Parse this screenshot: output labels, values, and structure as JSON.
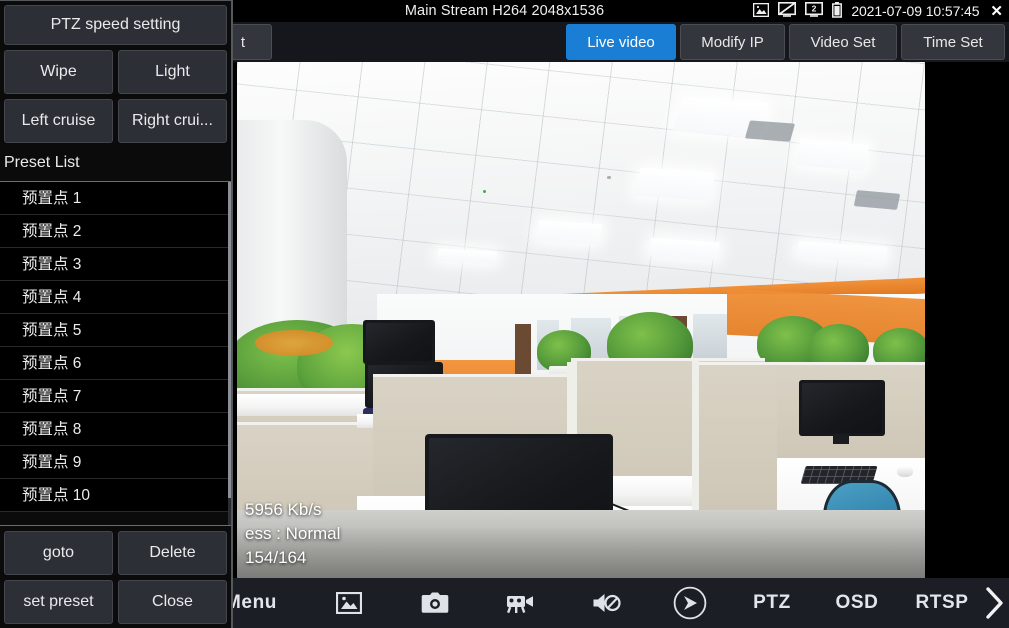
{
  "statusbar": {
    "stream_title": "Main Stream H264 2048x1536",
    "datetime": "2021-07-09 10:57:45",
    "close_label": "✕",
    "icons": [
      {
        "name": "picture-icon",
        "glyph": "image"
      },
      {
        "name": "screen-off-icon",
        "glyph": "monitor-crossed"
      },
      {
        "name": "screen-two-icon",
        "glyph": "monitor-2"
      },
      {
        "name": "battery-icon",
        "glyph": "battery"
      }
    ]
  },
  "tabs": {
    "hidden_label": "t",
    "items": [
      {
        "label": "Live video",
        "active": true
      },
      {
        "label": "Modify IP",
        "active": false
      },
      {
        "label": "Video Set",
        "active": false
      },
      {
        "label": "Time Set",
        "active": false
      }
    ]
  },
  "video": {
    "osd": {
      "bitrate": "5956 Kb/s",
      "progress": "ess : Normal",
      "frames": "154/164"
    }
  },
  "toolbar": {
    "menu_label": "Menu",
    "ptz_label": "PTZ",
    "osd_label": "OSD",
    "rtsp_label": "RTSP",
    "icons": [
      {
        "name": "picture-icon"
      },
      {
        "name": "camera-icon"
      },
      {
        "name": "video-camera-icon"
      },
      {
        "name": "mute-speaker-icon"
      },
      {
        "name": "play-circle-icon"
      },
      {
        "name": "chevron-right-icon"
      }
    ]
  },
  "ptz_panel": {
    "speed_setting_label": "PTZ speed setting",
    "wipe_label": "Wipe",
    "light_label": "Light",
    "left_cruise_label": "Left cruise",
    "right_cruise_label": "Right crui...",
    "preset_list_title": "Preset List",
    "presets": [
      "预置点 1",
      "预置点 2",
      "预置点 3",
      "预置点 4",
      "预置点 5",
      "预置点 6",
      "预置点 7",
      "预置点 8",
      "预置点 9",
      "预置点 10"
    ],
    "goto_label": "goto",
    "delete_label": "Delete",
    "set_preset_label": "set preset",
    "close_label": "Close"
  },
  "colors": {
    "accent": "#1a7fd4",
    "panel_bg": "#0b0b0c",
    "button_bg": "#2c2f35",
    "toolbar_bg": "#1b1e24"
  }
}
